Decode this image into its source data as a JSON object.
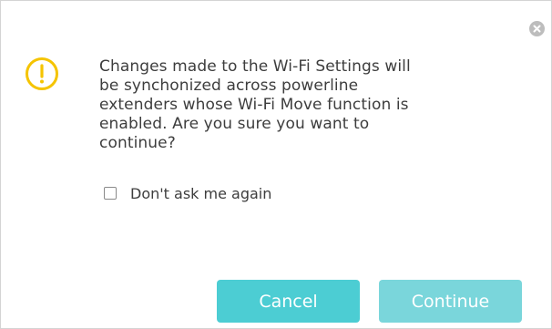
{
  "dialog": {
    "message_lines": [
      "Changes made to the Wi-Fi Settings will",
      "be synchonized across powerline",
      "extenders whose Wi-Fi Move function is",
      "enabled. Are you sure you want to",
      "continue?"
    ],
    "checkbox_label": "Don't ask me again",
    "checkbox_checked": false,
    "cancel_label": "Cancel",
    "continue_label": "Continue",
    "icons": {
      "warning": "warning-circle-icon",
      "close": "close-icon"
    },
    "colors": {
      "warning": "#f5c400",
      "button_primary": "#4ccdd3",
      "button_secondary": "#7ad6db",
      "close_bg": "#bdbdbd",
      "text": "#3d3d3d"
    }
  }
}
